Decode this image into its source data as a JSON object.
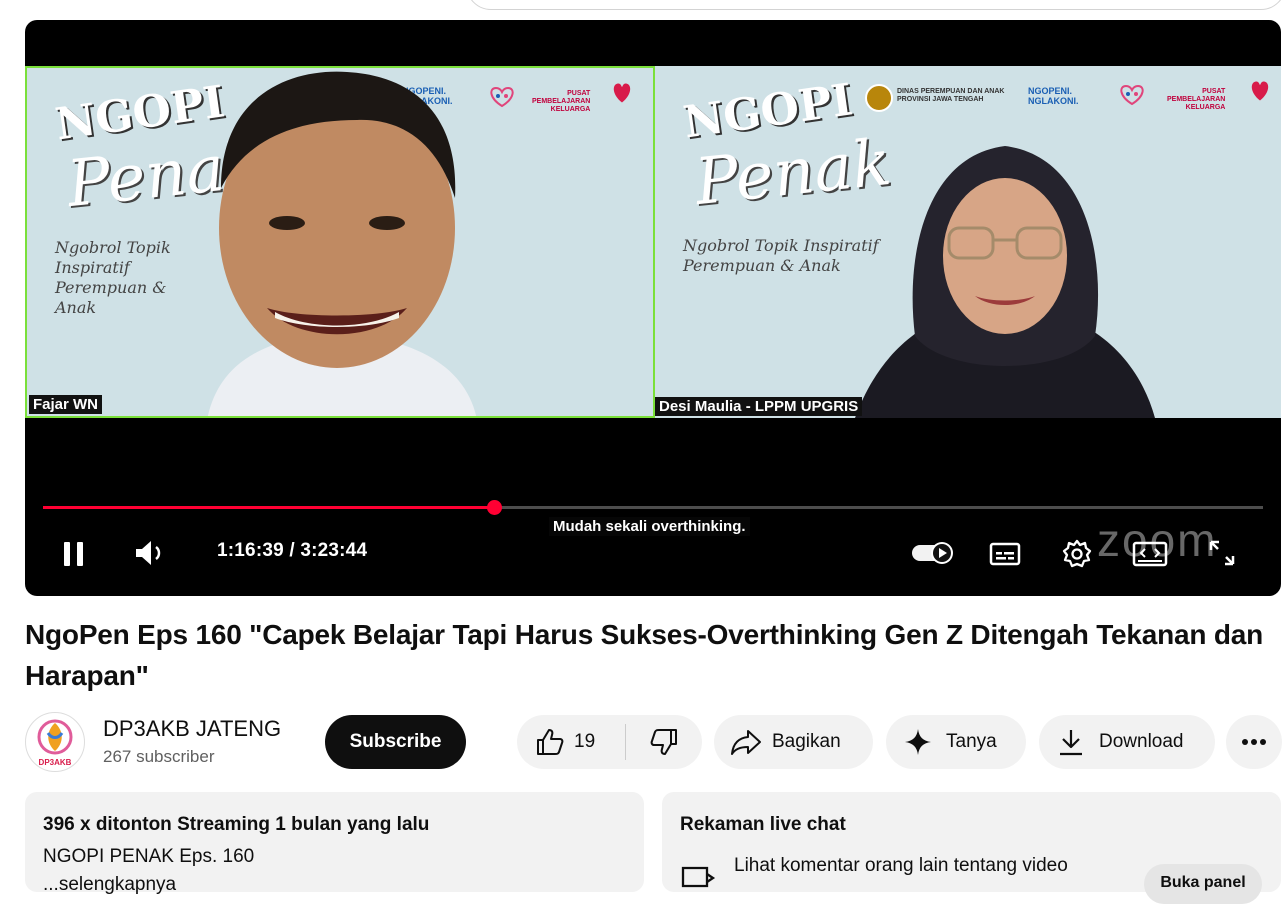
{
  "player": {
    "left_panel": {
      "brand": "NGOPI",
      "brand_script": "Penak",
      "tagline": "Ngobrol Topik Inspiratif Perempuan & Anak",
      "name_tag": "Fajar WN"
    },
    "right_panel": {
      "brand": "NGOPI",
      "brand_script": "Penak",
      "tagline_1": "Ngobrol Topik Inspiratif",
      "tagline_2": "Perempuan & Anak",
      "dinas_text_1": "DINAS PEREMPUAN DAN ANAK",
      "dinas_text_2": "PROVINSI JAWA TENGAH",
      "ngopeni_1": "NGOPENI.",
      "ngopeni_2": "NGLAKONI.",
      "pusat_1": "PUSAT",
      "pusat_2": "PEMBELAJARAN",
      "pusat_3": "KELUARGA",
      "name_tag": "Desi Maulia - LPPM UPGRIS"
    },
    "caption": "Mudah sekali overthinking.",
    "time_display": "1:16:39 / 3:23:44",
    "progress_fraction": 0.37,
    "watermark": "zoom",
    "icons": {
      "pause": "pause-icon",
      "volume": "volume-icon",
      "autoplay": "autoplay-toggle-icon",
      "subtitles": "subtitles-icon",
      "settings": "gear-icon",
      "miniplayer": "miniplayer-icon",
      "fullscreen": "fullscreen-icon"
    },
    "accent": "#ff0033"
  },
  "video": {
    "title": "NgoPen Eps 160 \"Capek Belajar Tapi Harus Sukses-Overthinking Gen Z Ditengah Tekanan dan Harapan\""
  },
  "channel": {
    "name": "DP3AKB JATENG",
    "subscribers": "267 subscriber",
    "avatar_text": "DP3AKB",
    "subscribe_label": "Subscribe"
  },
  "actions": {
    "like_count": "19",
    "share_label": "Bagikan",
    "ask_label": "Tanya",
    "download_label": "Download"
  },
  "description": {
    "meta": "396 x ditonton  Streaming 1 bulan yang lalu",
    "line1": "NGOPI PENAK Eps. 160",
    "line2": "...selengkapnya"
  },
  "live_chat": {
    "title": "Rekaman live chat",
    "desc": "Lihat komentar orang lain tentang video",
    "button": "Buka panel"
  }
}
